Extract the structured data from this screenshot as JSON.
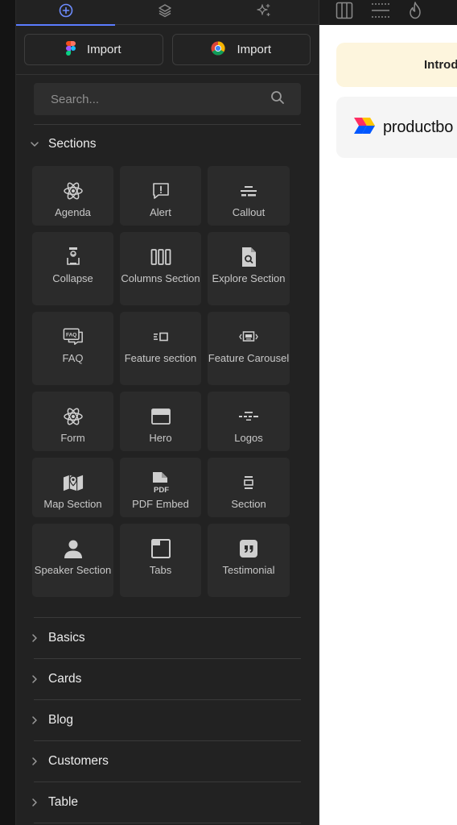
{
  "tabs": [
    {
      "icon": "plus-circle-icon",
      "active": true
    },
    {
      "icon": "layers-icon",
      "active": false
    },
    {
      "icon": "sparkles-icon",
      "active": false
    }
  ],
  "imports": [
    {
      "label": "Import",
      "icon": "figma-icon"
    },
    {
      "label": "Import",
      "icon": "chrome-icon"
    }
  ],
  "search": {
    "placeholder": "Search..."
  },
  "sections": {
    "label": "Sections",
    "items": [
      {
        "label": "Agenda",
        "icon": "react-atom-icon"
      },
      {
        "label": "Alert",
        "icon": "message-alert-icon"
      },
      {
        "label": "Callout",
        "icon": "callout-icon"
      },
      {
        "label": "Collapse",
        "icon": "collapse-icon"
      },
      {
        "label": "Columns Section",
        "icon": "columns-icon"
      },
      {
        "label": "Explore Section",
        "icon": "file-search-icon"
      },
      {
        "label": "FAQ",
        "icon": "faq-icon"
      },
      {
        "label": "Feature section",
        "icon": "feature-section-icon"
      },
      {
        "label": "Feature Carousel",
        "icon": "carousel-icon"
      },
      {
        "label": "Form",
        "icon": "react-atom-icon"
      },
      {
        "label": "Hero",
        "icon": "hero-icon"
      },
      {
        "label": "Logos",
        "icon": "logos-icon"
      },
      {
        "label": "Map Section",
        "icon": "map-icon"
      },
      {
        "label": "PDF Embed",
        "icon": "pdf-icon"
      },
      {
        "label": "Section",
        "icon": "section-icon"
      },
      {
        "label": "Speaker Section",
        "icon": "person-icon"
      },
      {
        "label": "Tabs",
        "icon": "tabs-icon"
      },
      {
        "label": "Testimonial",
        "icon": "quote-icon"
      }
    ]
  },
  "collapsed_groups": [
    {
      "label": "Basics"
    },
    {
      "label": "Cards"
    },
    {
      "label": "Blog"
    },
    {
      "label": "Customers"
    },
    {
      "label": "Table"
    }
  ],
  "canvas": {
    "banner_text": "Introd",
    "logo_text": "productbo"
  },
  "colors": {
    "accent": "#5b7cff",
    "panel_bg": "#222222",
    "card_bg": "#2b2b2b",
    "banner_bg": "#fdf5dd"
  }
}
